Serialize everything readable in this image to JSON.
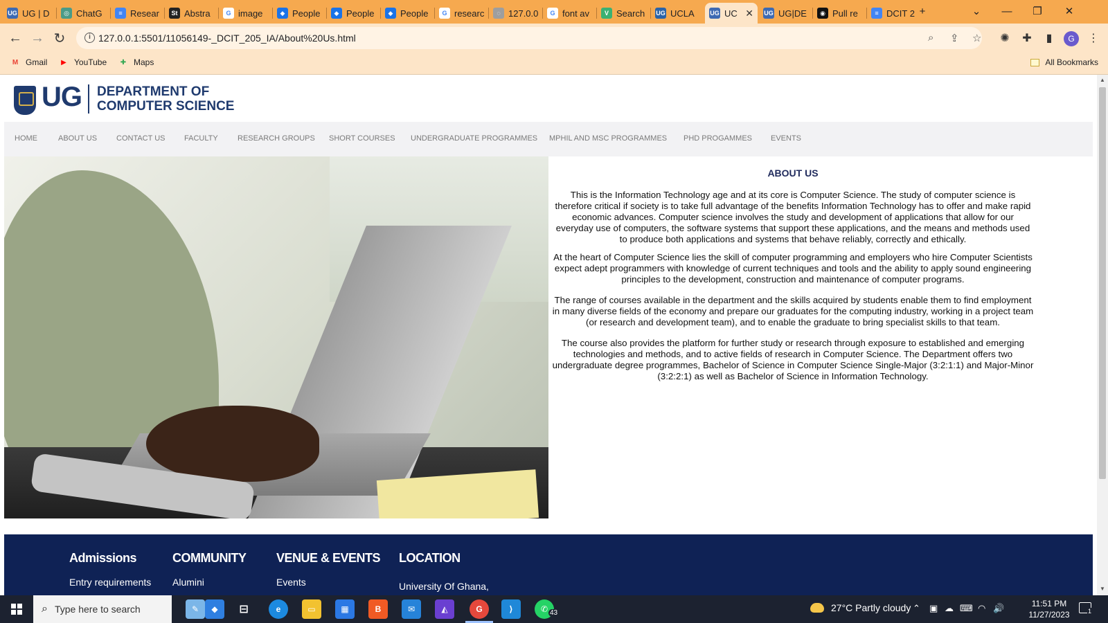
{
  "browser": {
    "tabs": [
      {
        "label": "UG | D",
        "fav": "#3d6ab3",
        "fav_text": "UG"
      },
      {
        "label": "ChatG",
        "fav": "#4a9b88",
        "fav_text": "◎"
      },
      {
        "label": "Resear",
        "fav": "#4285f4",
        "fav_text": "≡"
      },
      {
        "label": "Abstra",
        "fav": "#222222",
        "fav_text": "St"
      },
      {
        "label": "image",
        "fav": "#ffffff",
        "fav_text": "G"
      },
      {
        "label": "People",
        "fav": "#1a73e8",
        "fav_text": "◆"
      },
      {
        "label": "People",
        "fav": "#1a73e8",
        "fav_text": "◆"
      },
      {
        "label": "People",
        "fav": "#1a73e8",
        "fav_text": "◆"
      },
      {
        "label": "researc",
        "fav": "#ffffff",
        "fav_text": "G"
      },
      {
        "label": "127.0.0",
        "fav": "#9e9e9e",
        "fav_text": "◌"
      },
      {
        "label": "font av",
        "fav": "#ffffff",
        "fav_text": "G"
      },
      {
        "label": "Search",
        "fav": "#3bb173",
        "fav_text": "V"
      },
      {
        "label": "UCLA",
        "fav": "#2b63a8",
        "fav_text": "UG"
      },
      {
        "label": "UC",
        "fav": "#3d6ab3",
        "fav_text": "UG",
        "active": true
      },
      {
        "label": "UG|DE",
        "fav": "#3d6ab3",
        "fav_text": "UG"
      },
      {
        "label": "Pull re",
        "fav": "#111111",
        "fav_text": "◉"
      },
      {
        "label": "DCIT 2",
        "fav": "#4285f4",
        "fav_text": "≡"
      }
    ],
    "new_tab": "+",
    "url": "127.0.0.1:5501/11056149-_DCIT_205_IA/About%20Us.html",
    "profile_initial": "G",
    "bookmarks": [
      {
        "label": "Gmail",
        "icon": "M",
        "color": "#ea4335"
      },
      {
        "label": "YouTube",
        "icon": "▶",
        "color": "#ff0000"
      },
      {
        "label": "Maps",
        "icon": "✚",
        "color": "#34a853"
      }
    ],
    "all_bookmarks": "All Bookmarks"
  },
  "site": {
    "logo_ug": "UG",
    "logo_dept_line1": "DEPARTMENT OF",
    "logo_dept_line2": "COMPUTER SCIENCE",
    "nav": [
      "HOME",
      "ABOUT US",
      "CONTACT US",
      "FACULTY",
      "RESEARCH GROUPS",
      "SHORT COURSES",
      "UNDERGRADUATE PROGRAMMES",
      "MPHIL AND MSC PROGRAMMES",
      "PHD PROGAMMES",
      "EVENTS"
    ],
    "about": {
      "title": "ABOUT US",
      "paragraphs": [
        [
          "This is the Information Technology age and at its core is Computer Science. The study of computer science is",
          "therefore critical if society is to take full advantage of the benefits Information Technology has to offer and make rapid",
          "economic advances. Computer science involves the study and development of applications that allow for our",
          "everyday use of computers, the software systems that support these applications, and the means and methods used",
          "to produce both applications and systems that behave reliably, correctly and ethically."
        ],
        [
          "At the heart of Computer Science lies the skill of computer programming and employers who hire Computer Scientists",
          "expect adept programmers with knowledge of current techniques and tools and the ability to apply sound engineering",
          "principles to the development, construction and maintenance of computer programs."
        ],
        [
          "The range of courses available in the department and the skills acquired by students enable them to find employment",
          "in many diverse fields of the economy and prepare our graduates for the computing industry, working in a project team",
          "(or research and development team), and to enable the graduate to bring specialist skills to that team."
        ],
        [
          "The course also provides the platform for further study or research through exposure to established and emerging",
          "technologies and methods, and to active fields of research in Computer Science. The Department offers two",
          "undergraduate degree programmes, Bachelor of Science in Computer Science Single-Major (3:2:1:1) and Major-Minor",
          "(3:2:2:1) as well as Bachelor of Science in Information Technology."
        ]
      ]
    },
    "footer": [
      {
        "heading": "Admissions",
        "item": "Entry requirements"
      },
      {
        "heading": "COMMUNITY",
        "item": "Alumini"
      },
      {
        "heading": "VENUE & EVENTS",
        "item": "Events"
      },
      {
        "heading": "LOCATION",
        "item": "University Of Ghana,"
      }
    ]
  },
  "taskbar": {
    "search_placeholder": "Type here to search",
    "weather": "27°C  Partly cloudy",
    "time": "11:51 PM",
    "date": "11/27/2023",
    "whatsapp_badge": "43",
    "notification_count": "1"
  }
}
